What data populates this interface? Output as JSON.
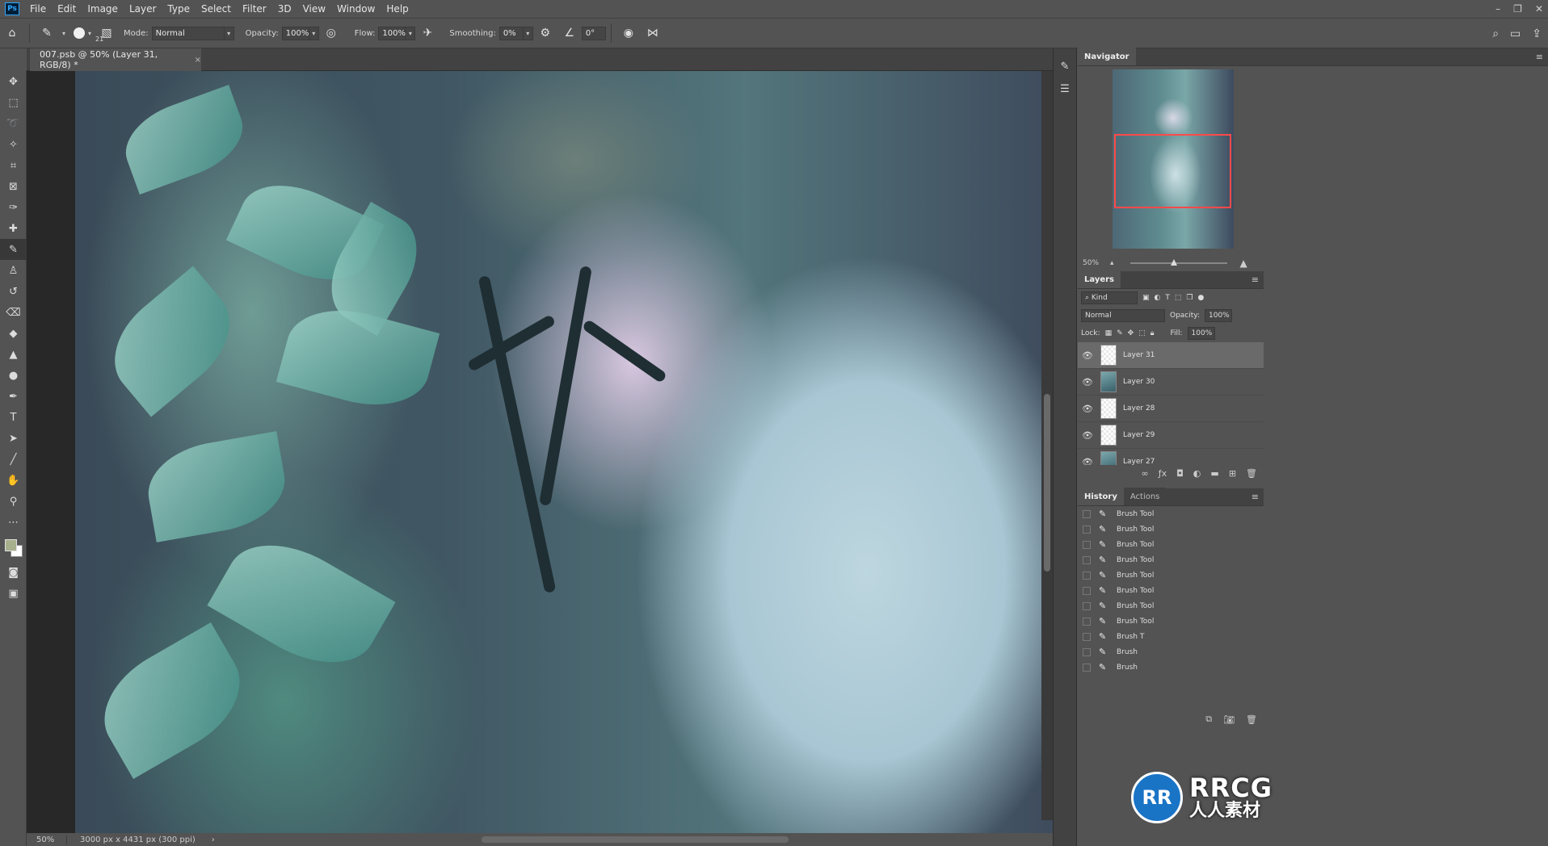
{
  "app": {
    "logo": "Ps"
  },
  "menu": [
    "File",
    "Edit",
    "Image",
    "Layer",
    "Type",
    "Select",
    "Filter",
    "3D",
    "View",
    "Window",
    "Help"
  ],
  "window_controls": {
    "minimize": "–",
    "restore": "❐",
    "close": "✕"
  },
  "options": {
    "brush_size": "21",
    "mode_label": "Mode:",
    "mode_value": "Normal",
    "opacity_label": "Opacity:",
    "opacity_value": "100%",
    "flow_label": "Flow:",
    "flow_value": "100%",
    "smoothing_label": "Smoothing:",
    "smoothing_value": "0%",
    "angle_value": "0°"
  },
  "document": {
    "tab_title": "007.psb @ 50% (Layer 31, RGB/8) *",
    "tab_close": "×"
  },
  "status": {
    "zoom": "50%",
    "info": "3000 px x 4431 px (300 ppi)",
    "arrow": "›"
  },
  "navigator": {
    "tab": "Navigator",
    "zoom": "50%"
  },
  "layers": {
    "tab": "Layers",
    "filter_value": "Kind",
    "blend_mode": "Normal",
    "opacity_label": "Opacity:",
    "opacity_value": "100%",
    "lock_label": "Lock:",
    "fill_label": "Fill:",
    "fill_value": "100%",
    "items": [
      {
        "name": "Layer 31",
        "selected": true,
        "thumb": "transparent"
      },
      {
        "name": "Layer 30",
        "selected": false,
        "thumb": "image"
      },
      {
        "name": "Layer 28",
        "selected": false,
        "thumb": "transparent"
      },
      {
        "name": "Layer 29",
        "selected": false,
        "thumb": "transparent"
      },
      {
        "name": "Layer 27",
        "selected": false,
        "thumb": "image"
      }
    ]
  },
  "history": {
    "tab": "History",
    "tab2": "Actions",
    "items": [
      "Brush Tool",
      "Brush Tool",
      "Brush Tool",
      "Brush Tool",
      "Brush Tool",
      "Brush Tool",
      "Brush Tool",
      "Brush Tool",
      "Brush T",
      "Brush",
      "Brush"
    ]
  },
  "watermark": {
    "badge": "RR",
    "title": "RRCG",
    "subtitle": "人人素材"
  },
  "colors": {
    "foreground": "#a7b08d",
    "background": "#ffffff",
    "navigator_rect": "#ff4a4a"
  }
}
